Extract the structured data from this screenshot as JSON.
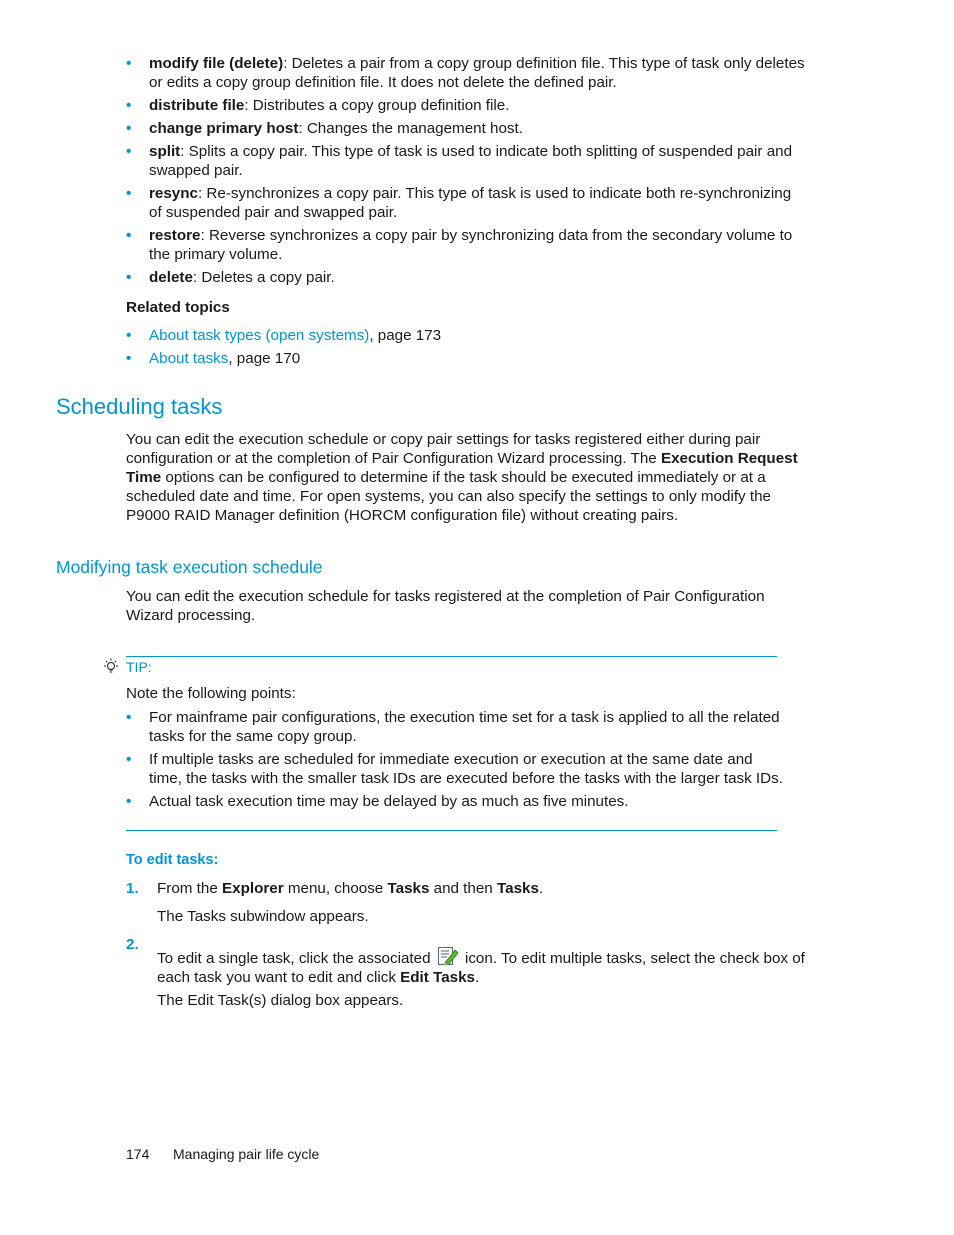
{
  "task_types": [
    {
      "term": "modify file (delete)",
      "desc": ": Deletes a pair from a copy group definition file. This type of task only deletes or edits a copy group definition file. It does not delete the defined pair."
    },
    {
      "term": "distribute file",
      "desc": ": Distributes a copy group definition file."
    },
    {
      "term": "change primary host",
      "desc": ": Changes the management host."
    },
    {
      "term": "split",
      "desc": ": Splits a copy pair. This type of task is used to indicate both splitting of suspended pair and swapped pair."
    },
    {
      "term": "resync",
      "desc": ": Re-synchronizes a copy pair. This type of task is used to indicate both re-synchronizing of suspended pair and swapped pair."
    },
    {
      "term": "restore",
      "desc": ": Reverse synchronizes a copy pair by synchronizing data from the secondary volume to the primary volume."
    },
    {
      "term": "delete",
      "desc": ": Deletes a copy pair."
    }
  ],
  "related_topics": {
    "heading": "Related topics",
    "links": [
      {
        "label": "About task types (open systems)",
        "suffix": ", page 173"
      },
      {
        "label": "About tasks",
        "suffix": ", page 170"
      }
    ]
  },
  "scheduling": {
    "title": "Scheduling tasks",
    "p_part1": "You can edit the execution schedule or copy pair settings for tasks registered either during pair configuration or at the completion of Pair Configuration Wizard processing. The ",
    "p_bold": "Execution Request Time",
    "p_part2": " options can be configured to determine if the task should be executed immediately or at a scheduled date and time. For open systems, you can also specify the settings to only modify the P9000 RAID Manager definition (HORCM configuration file) without creating pairs."
  },
  "modifying": {
    "title": "Modifying task execution schedule",
    "intro": "You can edit the execution schedule for tasks registered at the completion of Pair Configuration Wizard processing."
  },
  "tip": {
    "label": "TIP:",
    "intro": "Note the following points:",
    "points": [
      "For mainframe pair configurations, the execution time set for a task is applied to all the related tasks for the same copy group.",
      "If multiple tasks are scheduled for immediate execution or execution at the same date and time, the tasks with the smaller task IDs are executed before the tasks with the larger task IDs.",
      "Actual task execution time may be delayed by as much as five minutes."
    ]
  },
  "procedure": {
    "heading": "To edit tasks:",
    "step1": {
      "num": "1.",
      "t1": "From the ",
      "b1": "Explorer",
      "t2": " menu, choose ",
      "b2": "Tasks",
      "t3": " and then ",
      "b3": "Tasks",
      "t4": ".",
      "result": "The Tasks subwindow appears."
    },
    "step2": {
      "num": "2.",
      "t1": "To edit a single task, click the associated ",
      "t2": " icon. To edit multiple tasks, select the check box of each task you want to edit and click ",
      "b1": "Edit Tasks",
      "t3": ".",
      "result": "The Edit Task(s) dialog box appears."
    }
  },
  "footer": {
    "page_number": "174",
    "chapter": "Managing pair life cycle"
  }
}
